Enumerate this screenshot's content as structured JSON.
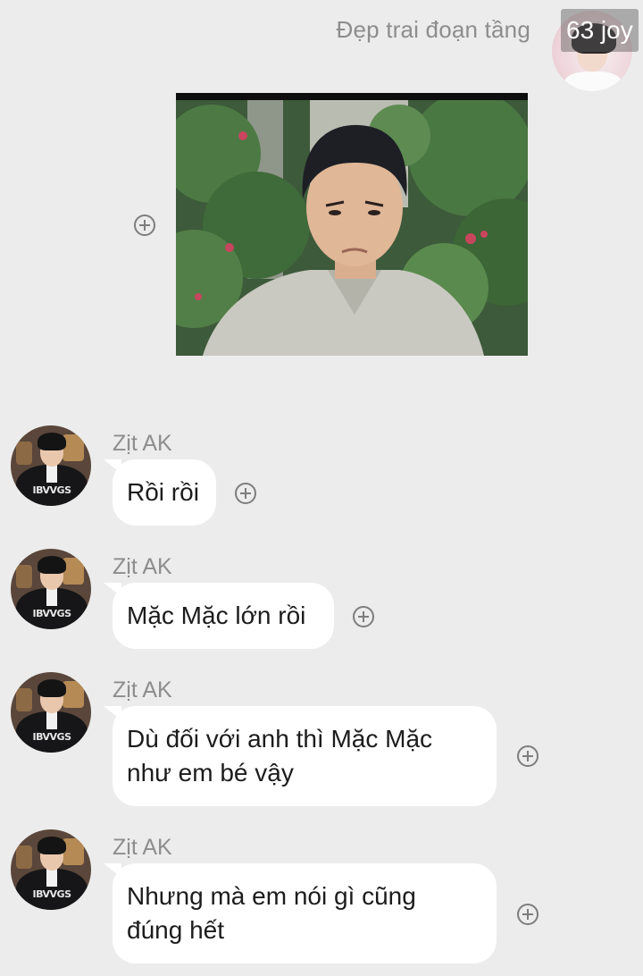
{
  "header": {
    "own_sender_name": "Đẹp trai đoạn tầng",
    "watermark": "63 joy"
  },
  "messages": [
    {
      "sender": "Zịt AK",
      "text": "Rồi rồi"
    },
    {
      "sender": "Zịt AK",
      "text": "Mặc Mặc lớn rồi"
    },
    {
      "sender": "Zịt AK",
      "text_line1": "Dù đối với anh thì Mặc Mặc",
      "text_line2": "như em bé vậy"
    },
    {
      "sender": "Zịt AK",
      "text_line1": "Nhưng mà em nói gì cũng",
      "text_line2": "đúng hết"
    }
  ],
  "icons": {
    "add_reaction": "plus-circle-icon"
  },
  "colors": {
    "background": "#ececec",
    "bubble": "#ffffff",
    "name_text": "#8d8d8d",
    "message_text": "#1c1c1c"
  }
}
